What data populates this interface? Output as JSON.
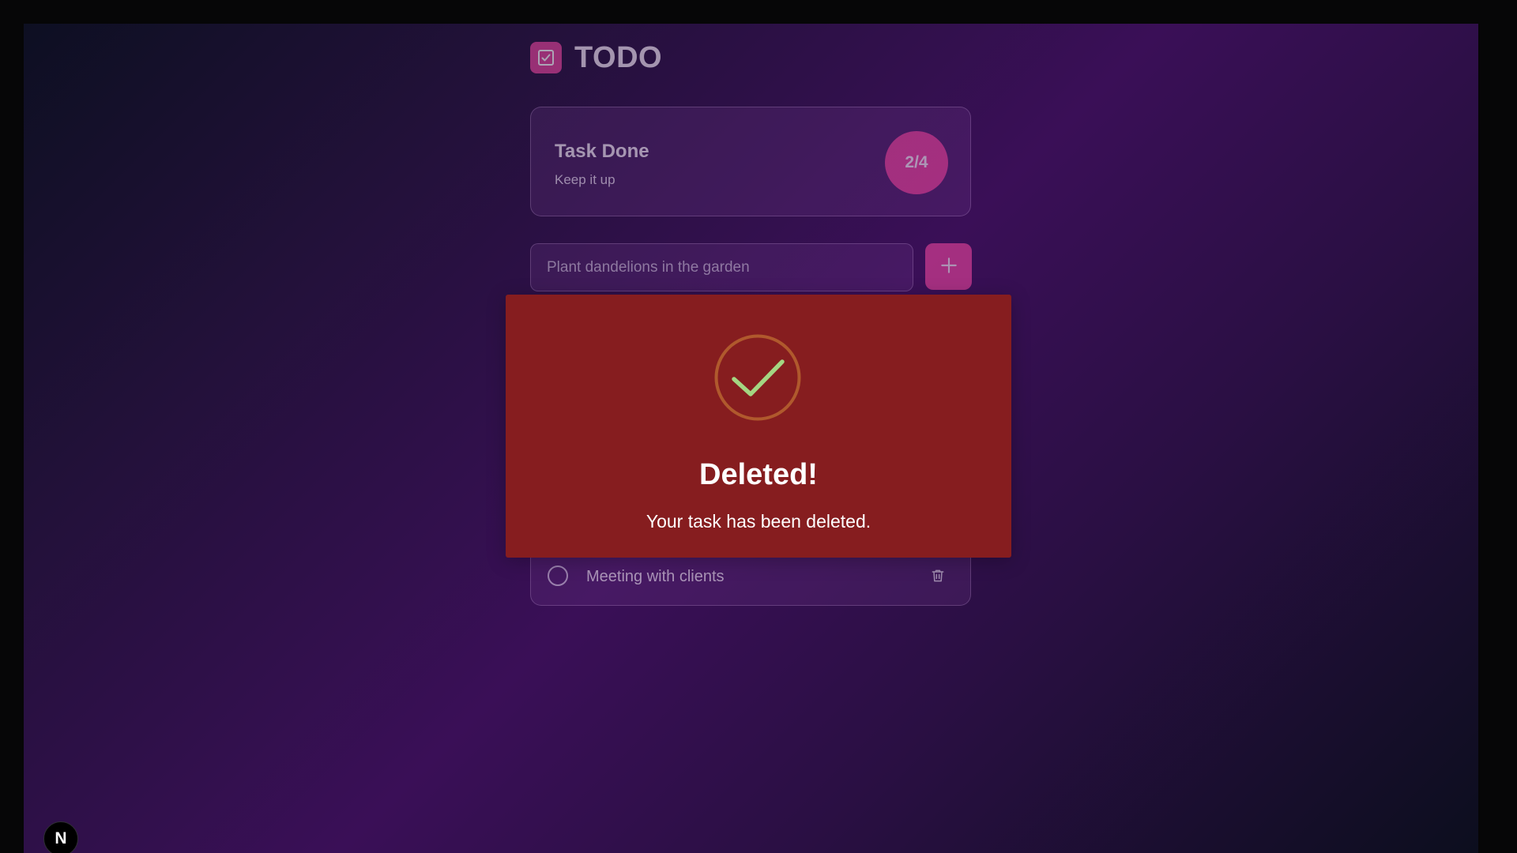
{
  "app": {
    "title": "TODO",
    "logo_icon": "checkbox-icon",
    "accent_color": "#e7449c"
  },
  "stats": {
    "title": "Task Done",
    "subtitle": "Keep it up",
    "progress": "2/4"
  },
  "new_task": {
    "placeholder": "Plant dandelions in the garden",
    "add_icon": "plus-icon"
  },
  "tasks": [
    {
      "text": "Meeting with clients",
      "completed": false,
      "delete_icon": "trash-icon"
    }
  ],
  "modal": {
    "title": "Deleted!",
    "message": "Your task has been deleted.",
    "icon": "success-check-icon",
    "background": "#861d1f"
  },
  "dev_badge": {
    "label": "N",
    "icon": "nextjs-icon"
  }
}
